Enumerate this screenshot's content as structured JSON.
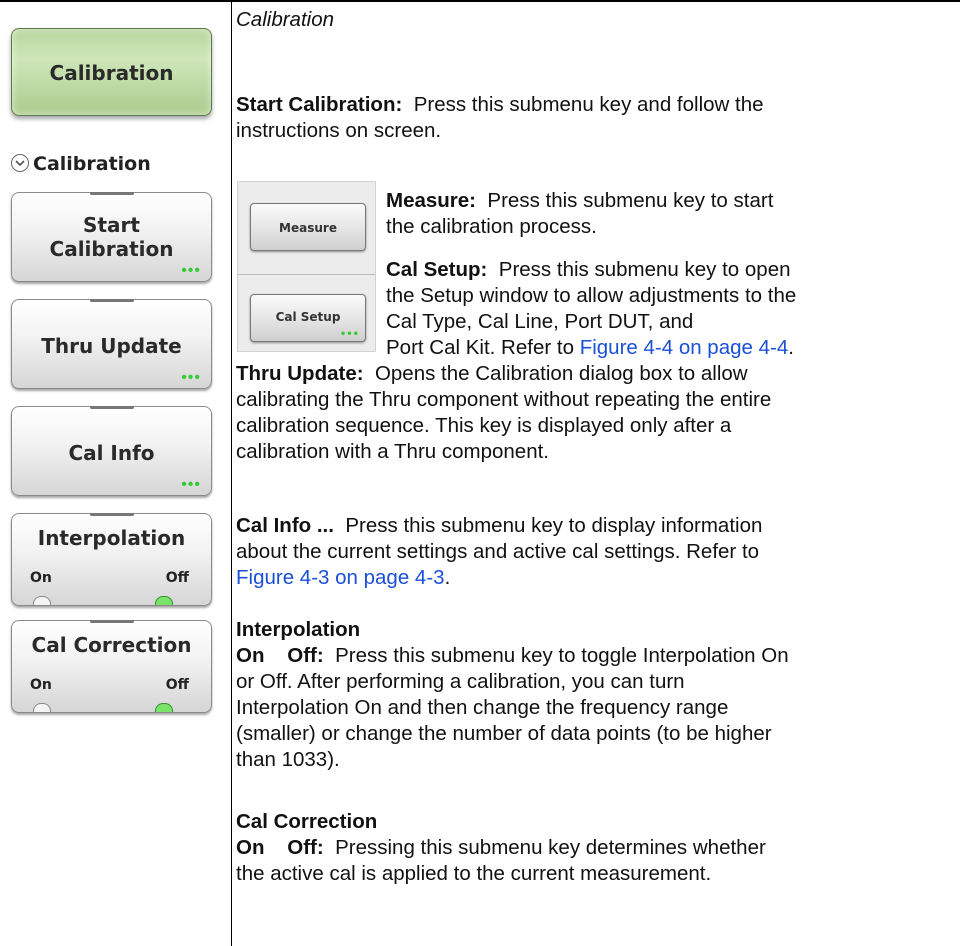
{
  "menu": {
    "top_button": "Calibration",
    "title": "Calibration",
    "keys": [
      {
        "label_line1": "Start",
        "label_line2": "Calibration",
        "dots": "•••"
      },
      {
        "label": "Thru Update",
        "dots": "•••"
      },
      {
        "label": "Cal Info",
        "dots": "•••"
      },
      {
        "label": "Interpolation",
        "on": "On",
        "off": "Off"
      },
      {
        "label": "Cal Correction",
        "on": "On",
        "off": "Off"
      }
    ]
  },
  "inset": {
    "measure": "Measure",
    "cal_setup": "Cal Setup",
    "dots": "•••"
  },
  "content": {
    "caption": "Calibration",
    "start_cal": {
      "term": "Start Calibration:",
      "line1": "Press this submenu key and follow the",
      "line2": "instructions on screen."
    },
    "measure": {
      "term": "Measure:",
      "line1": "Press this submenu key to start",
      "line2": "the calibration process."
    },
    "cal_setup": {
      "term": "Cal Setup:",
      "line1": "Press this submenu key to open",
      "line2": "the Setup window to allow adjustments to the",
      "line3": "Cal Type, Cal Line, Port DUT, and",
      "line4_pre": "Port Cal Kit. Refer to ",
      "line4_link": "Figure 4-4 on page 4-4",
      "line4_post": "."
    },
    "thru_update": {
      "term": "Thru Update:",
      "line1": "Opens the Calibration dialog box to allow",
      "line2": "calibrating the Thru component without repeating the entire",
      "line3": "calibration sequence. This key is displayed only after a",
      "line4": "calibration with a Thru component."
    },
    "cal_info": {
      "term": "Cal Info ...",
      "line1": "Press this submenu key to display information",
      "line2": "about the current settings and active cal settings. Refer to",
      "line3_link": "Figure 4-3 on page 4-3",
      "line3_post": "."
    },
    "interpolation": {
      "heading": "Interpolation",
      "term": "On    Off:",
      "line1": "Press this submenu key to toggle Interpolation On",
      "line2": "or Off. After performing a calibration, you can turn",
      "line3": "Interpolation On and then change the frequency range",
      "line4": "(smaller) or change the number of data points (to be higher",
      "line5": "than 1033)."
    },
    "cal_correction": {
      "heading": "Cal Correction",
      "term": "On    Off:",
      "line1": "Pressing this submenu key determines whether",
      "line2": "the active cal is applied to the current measurement."
    }
  },
  "colors": {
    "link": "#1a4fd6",
    "indicator_on": "#7be36a",
    "top_key": "#b7d59d"
  }
}
